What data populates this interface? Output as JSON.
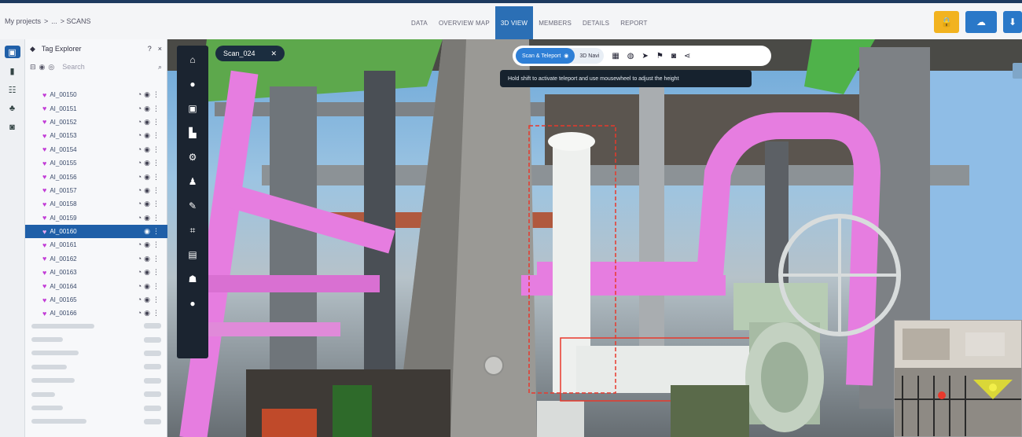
{
  "breadcrumb": [
    "My projects",
    ">",
    "...",
    "> SCANS"
  ],
  "nav_tabs": [
    {
      "label": "DATA",
      "active": false
    },
    {
      "label": "OVERVIEW MAP",
      "active": false
    },
    {
      "label": "3D VIEW",
      "active": true
    },
    {
      "label": "MEMBERS",
      "active": false
    },
    {
      "label": "DETAILS",
      "active": false
    },
    {
      "label": "REPORT",
      "active": false
    }
  ],
  "explorer": {
    "title": "Tag Explorer",
    "help": "?",
    "close": "×",
    "search_placeholder": "Search",
    "tags": [
      {
        "label": "AI_00150",
        "selected": false
      },
      {
        "label": "AI_00151",
        "selected": false
      },
      {
        "label": "AI_00152",
        "selected": false
      },
      {
        "label": "AI_00153",
        "selected": false
      },
      {
        "label": "AI_00154",
        "selected": false
      },
      {
        "label": "AI_00155",
        "selected": false
      },
      {
        "label": "AI_00156",
        "selected": false
      },
      {
        "label": "AI_00157",
        "selected": false
      },
      {
        "label": "AI_00158",
        "selected": false
      },
      {
        "label": "AI_00159",
        "selected": false
      },
      {
        "label": "AI_00160",
        "selected": true
      },
      {
        "label": "AI_00161",
        "selected": false
      },
      {
        "label": "AI_00162",
        "selected": false
      },
      {
        "label": "AI_00163",
        "selected": false
      },
      {
        "label": "AI_00164",
        "selected": false
      },
      {
        "label": "AI_00165",
        "selected": false
      },
      {
        "label": "AI_00166",
        "selected": false
      }
    ]
  },
  "scan_chip": {
    "label": "Scan_024",
    "close": "✕"
  },
  "navbar": {
    "mode_active": "Scan & Teleport",
    "mode_other": "3D Navi"
  },
  "hint": "Hold shift to activate teleport and use mousewheel to adjust the height",
  "colors": {
    "accent": "#2b6fb5",
    "pipe_pink": "#e67de0",
    "steel_green": "#3fbf3a",
    "warning": "#f2b320"
  }
}
